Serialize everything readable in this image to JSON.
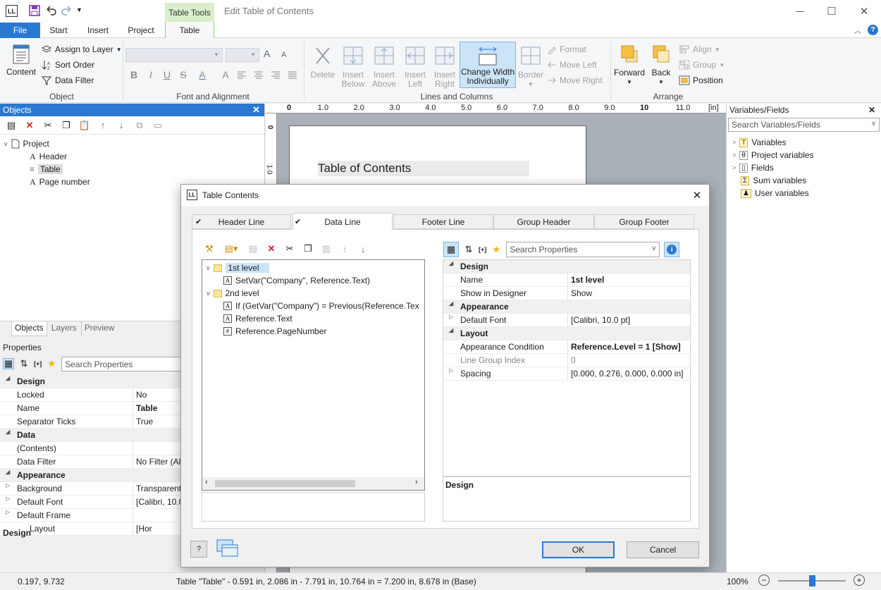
{
  "window": {
    "logo": "LL",
    "context_tab": "Table Tools",
    "title": "Edit Table of Contents",
    "minimize_glyph": "─",
    "maximize_glyph": "☐",
    "close_glyph": "✕"
  },
  "tabs": {
    "file": "File",
    "start": "Start",
    "insert": "Insert",
    "project": "Project",
    "table": "Table"
  },
  "ribbon": {
    "object_group": {
      "label": "Object",
      "content": "Content",
      "assign_to_layer": "Assign to Layer",
      "sort_order": "Sort Order",
      "data_filter": "Data Filter"
    },
    "font_group": {
      "label": "Font and Alignment",
      "bold": "B",
      "italic": "I",
      "underline": "U",
      "strike": "S",
      "font_color": "A",
      "grow": "A",
      "shrink": "A"
    },
    "lines_group": {
      "label": "Lines and Columns",
      "delete": "Delete",
      "insert_below_1": "Insert",
      "insert_below_2": "Below",
      "insert_above_1": "Insert",
      "insert_above_2": "Above",
      "insert_left_1": "Insert",
      "insert_left_2": "Left",
      "insert_right_1": "Insert",
      "insert_right_2": "Right",
      "change_width_1": "Change Width",
      "change_width_2": "Individually",
      "border": "Border",
      "format": "Format",
      "move_left": "Move Left",
      "move_right": "Move Right"
    },
    "arrange_group": {
      "label": "Arrange",
      "forward": "Forward",
      "back": "Back",
      "align": "Align",
      "group": "Group",
      "position": "Position"
    }
  },
  "objects_panel": {
    "title": "Objects",
    "tree": [
      "Project",
      "Header",
      "Table",
      "Page number"
    ],
    "bottom_tabs": [
      "Objects",
      "Layers",
      "Preview"
    ]
  },
  "properties_panel": {
    "title": "Properties",
    "search_placeholder": "Search Properties",
    "rows": [
      {
        "k": "Design",
        "v": "",
        "cat": true
      },
      {
        "k": "Locked",
        "v": "No"
      },
      {
        "k": "Name",
        "v": "Table",
        "bold": true
      },
      {
        "k": "Separator Ticks",
        "v": "True"
      },
      {
        "k": "Data",
        "v": "",
        "cat": true
      },
      {
        "k": "(Contents)",
        "v": ""
      },
      {
        "k": "Data Filter",
        "v": "No Filter (All"
      },
      {
        "k": "Appearance",
        "v": "",
        "cat": true
      },
      {
        "k": "Background",
        "v": "Transparent"
      },
      {
        "k": "Default Font",
        "v": "[Calibri, 10.0"
      },
      {
        "k": "Default Frame",
        "v": ""
      },
      {
        "k": "Layout",
        "v": "[Hor"
      }
    ],
    "footer_label": "Design"
  },
  "ruler": {
    "labels": [
      "0",
      "1.0",
      "2.0",
      "3.0",
      "4.0",
      "5.0",
      "6.0",
      "7.0",
      "8.0",
      "9.0",
      "10",
      "11.0"
    ],
    "unit": "[in]",
    "v_labels": [
      "0",
      "1.0"
    ]
  },
  "canvas": {
    "heading": "Table of Contents"
  },
  "variables_panel": {
    "title": "Variables/Fields",
    "search_placeholder": "Search Variables/Fields",
    "items": [
      "Variables",
      "Project variables",
      "Fields",
      "Sum variables",
      "User variables"
    ]
  },
  "dialog": {
    "title": "Table Contents",
    "tabs": [
      "Header Line",
      "Data Line",
      "Footer Line",
      "Group Header",
      "Group Footer"
    ],
    "tree": [
      {
        "label": "1st level",
        "level": 0,
        "folder": true
      },
      {
        "label": "SetVar(\"Company\", Reference.Text)",
        "level": 1
      },
      {
        "label": "2nd level",
        "level": 0,
        "folder": true
      },
      {
        "label": "If (GetVar(\"Company\") = Previous(Reference.Tex",
        "level": 1
      },
      {
        "label": "Reference.Text",
        "level": 1
      },
      {
        "label": "Reference.PageNumber",
        "level": 1
      }
    ],
    "search_placeholder": "Search Properties",
    "props": [
      {
        "k": "Design",
        "v": "",
        "cat": true
      },
      {
        "k": "Name",
        "v": "1st level",
        "bold": true
      },
      {
        "k": "Show in Designer",
        "v": "Show"
      },
      {
        "k": "Appearance",
        "v": "",
        "cat": true
      },
      {
        "k": "Default Font",
        "v": "[Calibri, 10.0 pt]",
        "expand": true
      },
      {
        "k": "Layout",
        "v": "",
        "cat": true
      },
      {
        "k": "Appearance Condition",
        "v": "Reference.Level = 1 [Show]",
        "bold": true
      },
      {
        "k": "Line Group Index",
        "v": "0",
        "dim": true
      },
      {
        "k": "Spacing",
        "v": "[0.000, 0.276, 0.000, 0.000 in]",
        "expand": true
      }
    ],
    "desc_label": "Design",
    "ok": "OK",
    "cancel": "Cancel",
    "close_glyph": "✕"
  },
  "status": {
    "coords": "0.197, 9.732",
    "object_info": "Table \"Table\"  - 0.591 in, 2.086 in  -  7.791 in, 10.764 in  =  7.200 in, 8.678 in (Base)",
    "zoom": "100%",
    "zoom_level": 0.5
  },
  "colors": {
    "accent": "#2b78d0",
    "context_green": "#d9eecb",
    "selection": "#cce4f7"
  }
}
